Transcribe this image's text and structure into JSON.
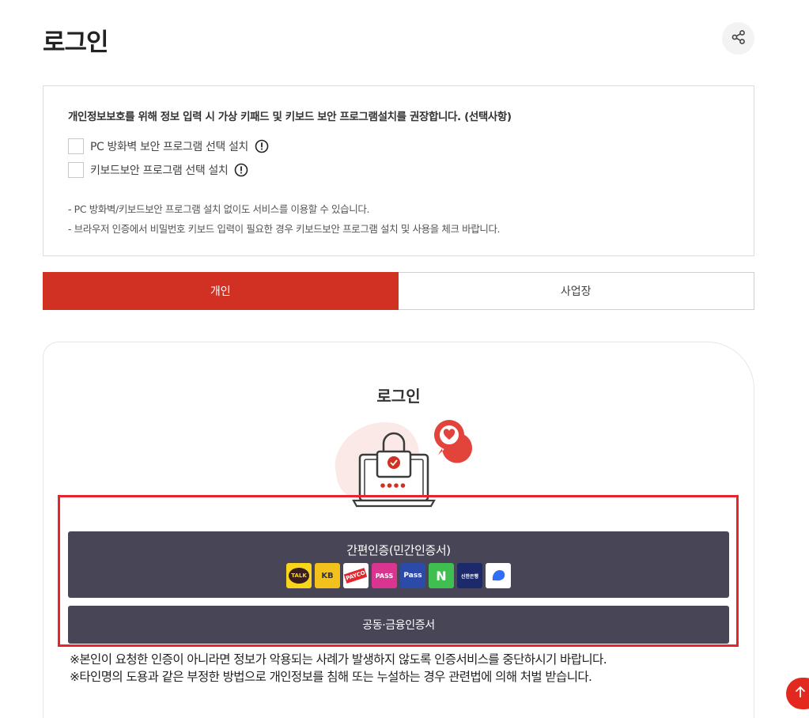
{
  "header": {
    "title": "로그인",
    "share_icon": "share-icon"
  },
  "security": {
    "title": "개인정보보호를 위해 정보 입력 시 가상 키패드 및 키보드 보안 프로그램설치를 권장합니다. (선택사항)",
    "options": [
      {
        "label": "PC 방화벽 보안 프로그램 선택 설치",
        "checked": false,
        "icon": "info-icon"
      },
      {
        "label": "키보드보안 프로그램 선택 설치",
        "checked": false,
        "icon": "info-icon"
      }
    ],
    "notes": [
      "-  PC 방화벽/키보드보안 프로그램 설치 없이도 서비스를 이용할 수 있습니다.",
      "-  브라우저 인증에서 비밀번호 키보드 입력이 필요한 경우 키보드보안 프로그램 설치 및 사용을 체크 바랍니다."
    ]
  },
  "tabs": [
    {
      "label": "개인",
      "active": true
    },
    {
      "label": "사업장",
      "active": false
    }
  ],
  "login": {
    "title": "로그인",
    "illustration": "lock-laptop-icon",
    "easy_auth": {
      "label": "간편인증(민간인증서)",
      "providers": [
        {
          "name": "kakao",
          "text": "TALK",
          "bg": "#f7d61b",
          "fg": "#3a1d1d"
        },
        {
          "name": "kb",
          "text": "KB",
          "bg": "#f2c11b",
          "fg": "#333333"
        },
        {
          "name": "payco",
          "text": "PAYCO",
          "bg": "#ffffff",
          "fg": "#e3262c"
        },
        {
          "name": "pass",
          "text": "PASS",
          "bg": "#d9348f",
          "fg": "#ffffff"
        },
        {
          "name": "samsung-pass",
          "text": "Pass",
          "bg": "#2c4aa8",
          "fg": "#ffffff"
        },
        {
          "name": "naver",
          "text": "N",
          "bg": "#3fbf4f",
          "fg": "#ffffff"
        },
        {
          "name": "shinhan",
          "text": "신한은행",
          "bg": "#1c2a6b",
          "fg": "#ffffff"
        },
        {
          "name": "toss",
          "text": "",
          "bg": "#ffffff",
          "fg": "#2f6ef5"
        }
      ]
    },
    "cert_label": "공동·금융인증서"
  },
  "warnings": [
    "※본인이 요청한 인증이 아니라면 정보가 악용되는 사례가 발생하지 않도록 인증서비스를 중단하시기 바랍니다.",
    "※타인명의 도용과 같은 부정한 방법으로 개인정보를 침해 또는 누설하는 경우 관련법에 의해 처벌 받습니다."
  ],
  "colors": {
    "accent": "#d03122",
    "button_dark": "#484556",
    "highlight": "#e8232d"
  },
  "top_button_icon": "arrow-up-icon"
}
